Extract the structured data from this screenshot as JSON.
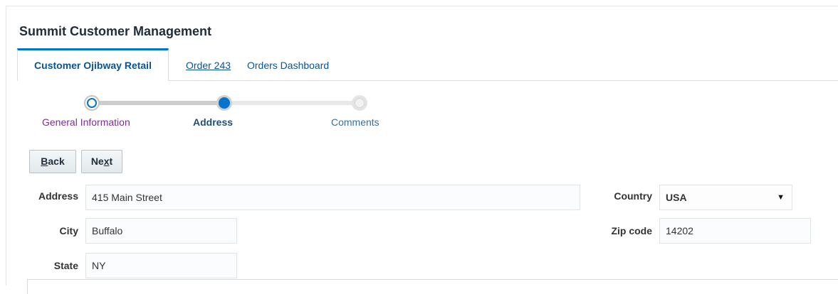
{
  "page": {
    "title": "Summit Customer Management"
  },
  "tabs": [
    {
      "label": "Customer Ojibway Retail"
    },
    {
      "label": "Order 243"
    },
    {
      "label": "Orders Dashboard"
    }
  ],
  "train": {
    "stops": [
      {
        "label": "General Information",
        "state": "visited"
      },
      {
        "label": "Address",
        "state": "current"
      },
      {
        "label": "Comments",
        "state": "unvisited"
      }
    ]
  },
  "buttons": {
    "back": {
      "accel": "B",
      "rest": "ack"
    },
    "next": {
      "pre": "Ne",
      "accel": "x",
      "rest": "t"
    }
  },
  "form": {
    "address": {
      "label": "Address",
      "value": "415 Main Street"
    },
    "city": {
      "label": "City",
      "value": "Buffalo"
    },
    "state": {
      "label": "State",
      "value": "NY"
    },
    "country": {
      "label": "Country",
      "value": "USA"
    },
    "zip": {
      "label": "Zip code",
      "value": "14202"
    }
  },
  "colors": {
    "accent": "#0572ce",
    "visited": "#7b2f93"
  }
}
